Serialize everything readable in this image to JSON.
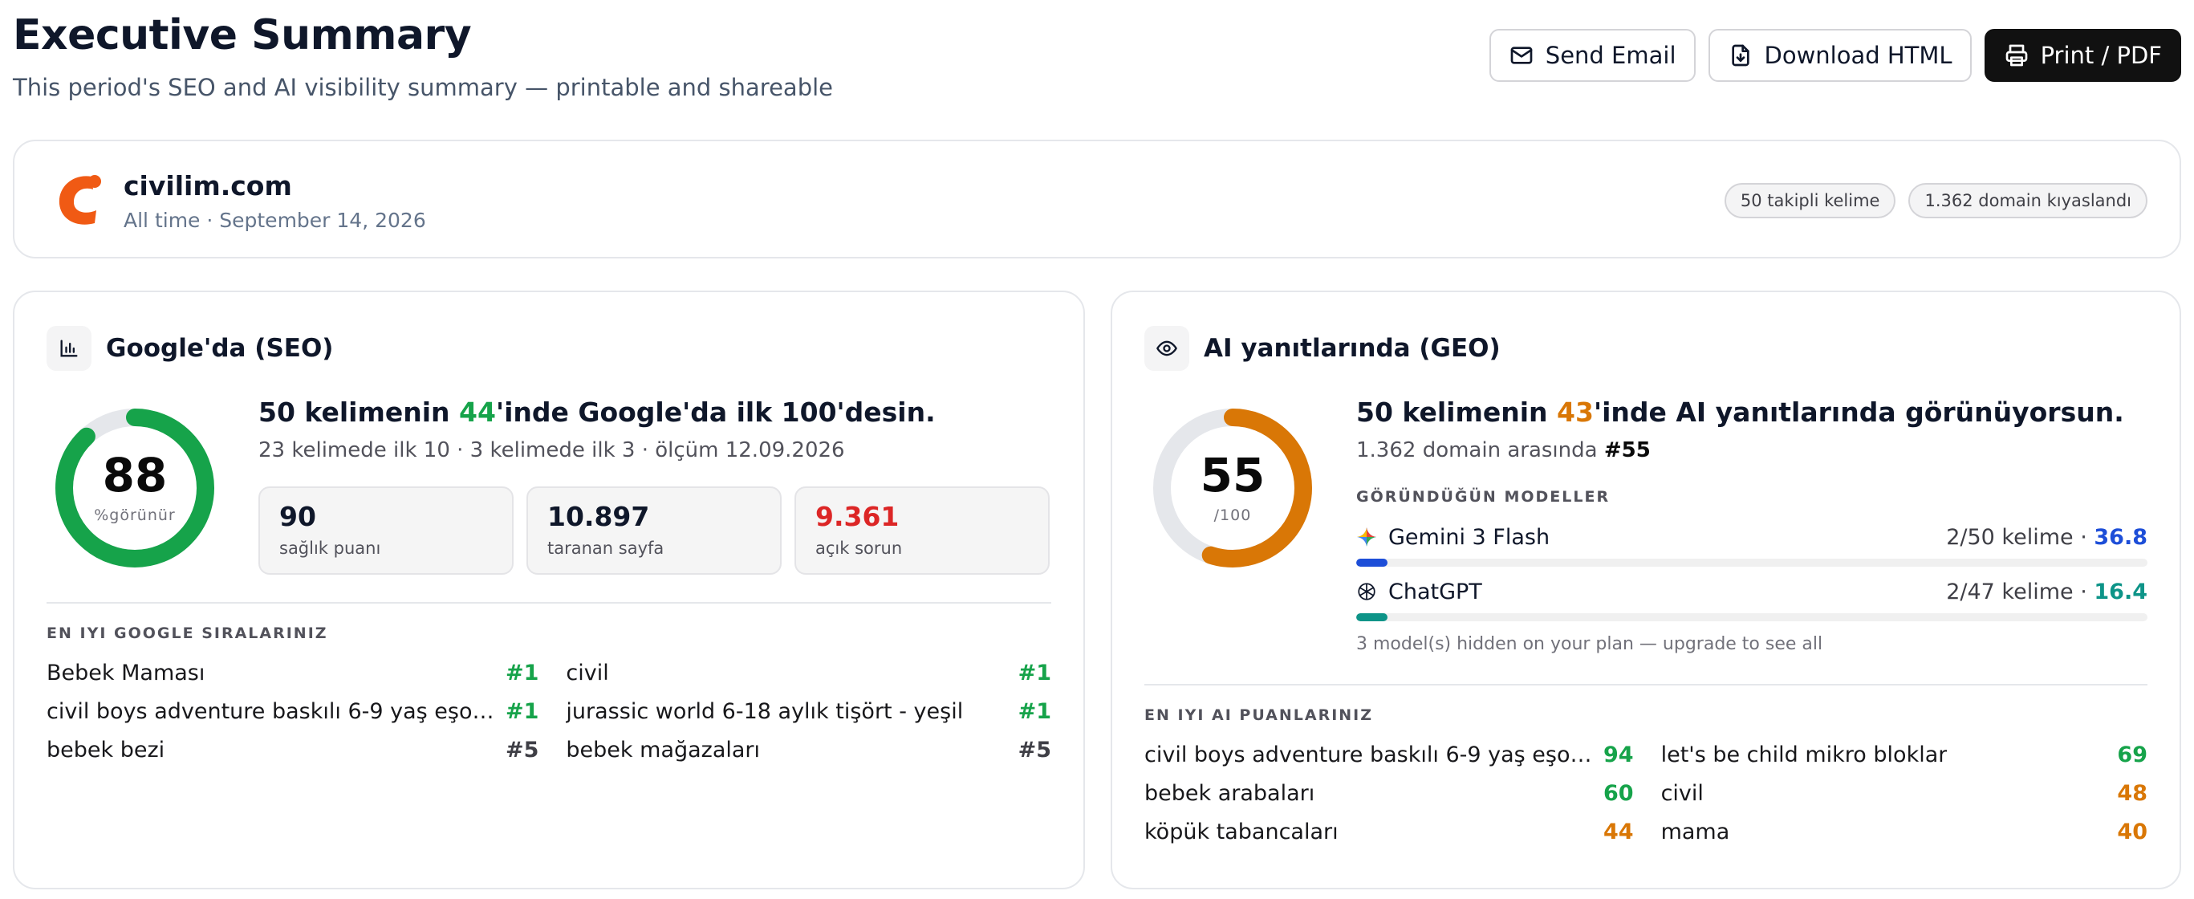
{
  "header": {
    "title": "Executive Summary",
    "subtitle": "This period's SEO and AI visibility summary — printable and shareable",
    "buttons": {
      "send_email": "Send Email",
      "download_html": "Download HTML",
      "print_pdf": "Print / PDF"
    }
  },
  "domain": {
    "name": "civilim.com",
    "meta": "All time · September 14, 2026",
    "badges": [
      "50 takipli kelime",
      "1.362 domain kıyaslandı"
    ],
    "logo_color": "#f05a14"
  },
  "seo": {
    "title": "Google'da (SEO)",
    "icon": "bar-chart-icon",
    "score": "88",
    "score_fraction": 0.88,
    "score_unit": "%görünür",
    "ring_color": "#16a34a",
    "headline_pre": "50 kelimenin ",
    "headline_num": "44",
    "headline_post": "'inde Google'da ilk 100'desin.",
    "subline": "23 kelimede ilk 10 · 3 kelimede ilk 3 · ölçüm 12.09.2026",
    "stats": [
      {
        "value": "90",
        "label": "sağlık puanı"
      },
      {
        "value": "10.897",
        "label": "taranan sayfa"
      },
      {
        "value": "9.361",
        "label": "açık sorun"
      }
    ],
    "rankings_label": "EN IYI GOOGLE SIRALARINIZ",
    "rankings": [
      {
        "keyword": "Bebek Maması",
        "rank": "#1"
      },
      {
        "keyword": "civil",
        "rank": "#1"
      },
      {
        "keyword": "civil boys adventure baskılı 6-9 yaş eşofman...",
        "rank": "#1"
      },
      {
        "keyword": "jurassic world 6-18 aylık tişört - yeşil",
        "rank": "#1"
      },
      {
        "keyword": "bebek bezi",
        "rank": "#5"
      },
      {
        "keyword": "bebek mağazaları",
        "rank": "#5"
      }
    ]
  },
  "geo": {
    "title": "AI yanıtlarında (GEO)",
    "icon": "eye-icon",
    "score": "55",
    "score_fraction": 0.55,
    "score_unit": "/100",
    "ring_color": "#d97706",
    "headline_pre": "50 kelimenin ",
    "headline_num": "43",
    "headline_post": "'inde AI yanıtlarında görünüyorsun.",
    "subline_pre": "1.362 domain arasında ",
    "subline_rank": "#55",
    "models_label": "GÖRÜNDÜĞÜN MODELLER",
    "models": [
      {
        "name": "Gemini 3 Flash",
        "icon": "gemini-icon",
        "count": "2/50 kelime · ",
        "score": "36.8",
        "fraction": 0.04,
        "color": "#1d4ed8"
      },
      {
        "name": "ChatGPT",
        "icon": "chatgpt-icon",
        "count": "2/47 kelime · ",
        "score": "16.4",
        "fraction": 0.04,
        "color": "#0d9488"
      }
    ],
    "hidden_note": "3 model(s) hidden on your plan — upgrade to see all",
    "scores_label": "EN IYI AI PUANLARINIZ",
    "scores": [
      {
        "keyword": "civil boys adventure baskılı 6-9 yaş eşofman...",
        "score": "94"
      },
      {
        "keyword": "let's be child mikro bloklar",
        "score": "69"
      },
      {
        "keyword": "bebek arabaları",
        "score": "60"
      },
      {
        "keyword": "civil",
        "score": "48"
      },
      {
        "keyword": "köpük tabancaları",
        "score": "44"
      },
      {
        "keyword": "mama",
        "score": "40"
      }
    ]
  }
}
